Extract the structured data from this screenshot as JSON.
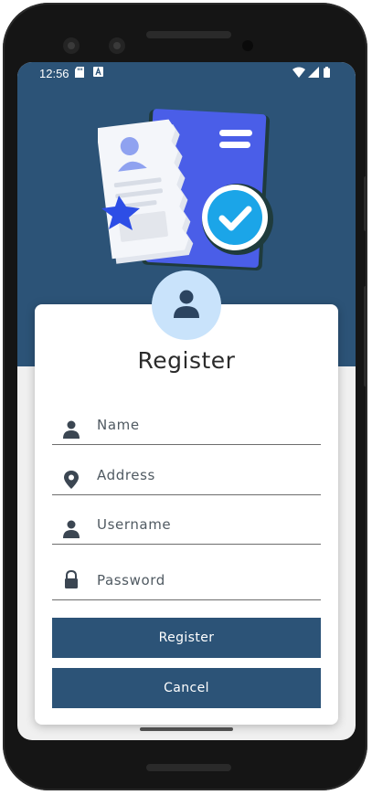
{
  "status_bar": {
    "time": "12:56",
    "icons": [
      "sd-card-icon",
      "a-icon",
      "wifi-icon",
      "signal-icon",
      "battery-icon"
    ]
  },
  "header": {
    "illustration": "registration-document-icon",
    "avatar": "user-avatar-icon"
  },
  "form": {
    "title": "Register",
    "fields": [
      {
        "placeholder": "Name",
        "icon": "person-icon"
      },
      {
        "placeholder": "Address",
        "icon": "location-pin-icon"
      },
      {
        "placeholder": "Username",
        "icon": "person-icon"
      },
      {
        "placeholder": "Password",
        "icon": "lock-icon"
      }
    ],
    "register_label": "Register",
    "cancel_label": "Cancel"
  },
  "colors": {
    "primary": "#2c5377",
    "avatar_bg": "#c9e3fb",
    "card": "#ffffff",
    "background": "#f0f0f0"
  }
}
